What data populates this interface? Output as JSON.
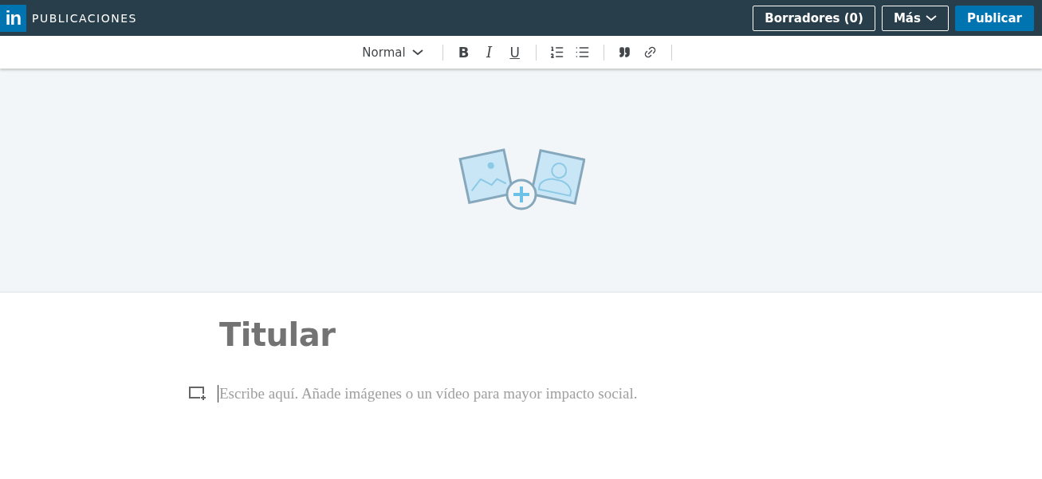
{
  "header": {
    "logo": "in",
    "title": "PUBLICACIONES",
    "buttons": [
      {
        "label": "Borradores (0)",
        "kind": "outline"
      },
      {
        "label": "Más",
        "kind": "dropdown"
      },
      {
        "label": "Publicar",
        "kind": "primary"
      }
    ]
  },
  "toolbar": {
    "style_select": "Normal",
    "groups": [
      [
        {
          "kind": "bold",
          "label": "B"
        },
        {
          "kind": "italic",
          "label": "I"
        },
        {
          "kind": "underline",
          "label": "U"
        }
      ],
      [
        {
          "kind": "numbered-list"
        },
        {
          "kind": "bulleted-list"
        }
      ],
      [
        {
          "kind": "quote"
        },
        {
          "kind": "link"
        }
      ]
    ]
  },
  "cover": {
    "kind": "image-upload"
  },
  "editor": {
    "title_placeholder": "Titular",
    "body_placeholder": "Escribe aquí. Añade imágenes o un vídeo para mayor impacto social."
  }
}
